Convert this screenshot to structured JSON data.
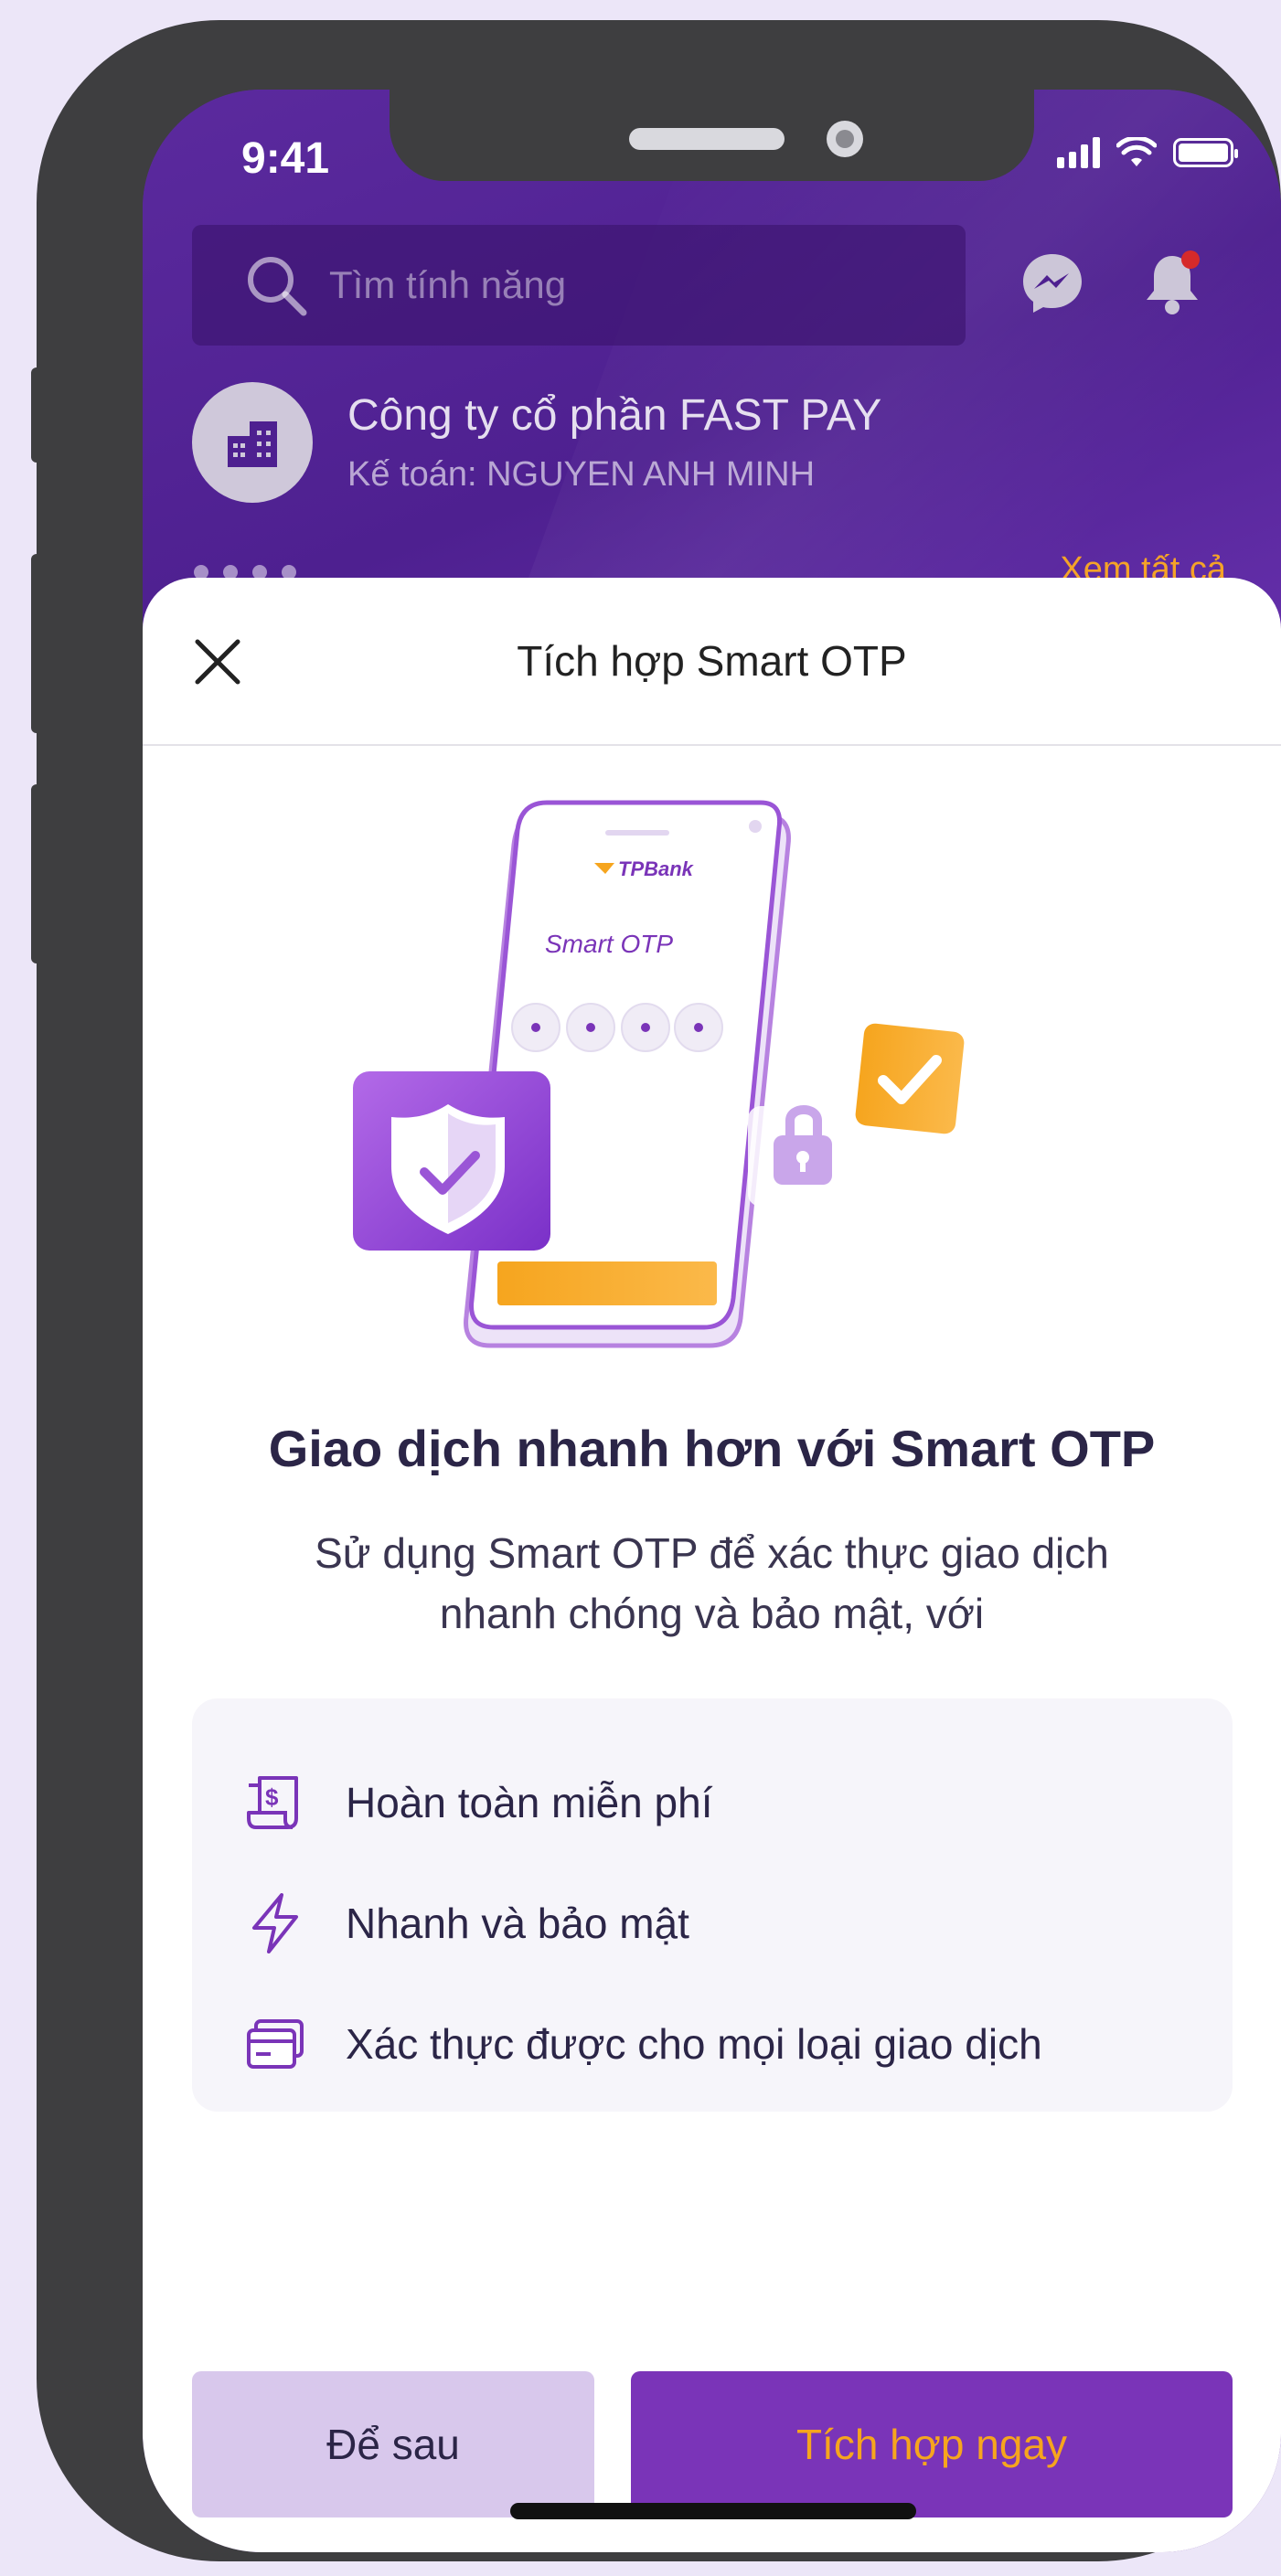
{
  "status_bar": {
    "time": "9:41"
  },
  "search": {
    "placeholder": "Tìm tính năng"
  },
  "company": {
    "name": "Công ty cổ phần FAST PAY",
    "role": "Kế toán: NGUYEN ANH MINH"
  },
  "carousel": {
    "see_all": "Xem tất cả"
  },
  "sheet": {
    "title": "Tích hợp Smart OTP",
    "illustration": {
      "brand": "TPBank",
      "label": "Smart OTP"
    },
    "headline": "Giao dịch nhanh hơn với Smart OTP",
    "description_line1": "Sử dụng Smart OTP để xác thực giao dịch",
    "description_line2": "nhanh chóng và bảo mật, với",
    "features": [
      {
        "icon": "receipt-dollar-icon",
        "label": "Hoàn toàn miễn phí"
      },
      {
        "icon": "lightning-icon",
        "label": "Nhanh và bảo mật"
      },
      {
        "icon": "card-icon",
        "label": "Xác thực được cho mọi loại giao dịch"
      }
    ],
    "buttons": {
      "later": "Để sau",
      "integrate_now": "Tích hợp ngay"
    }
  },
  "colors": {
    "primary": "#7A34B8",
    "accent": "#F6A51E",
    "secondary_button": "#D8C8EC",
    "background": "#ECE6F8"
  }
}
